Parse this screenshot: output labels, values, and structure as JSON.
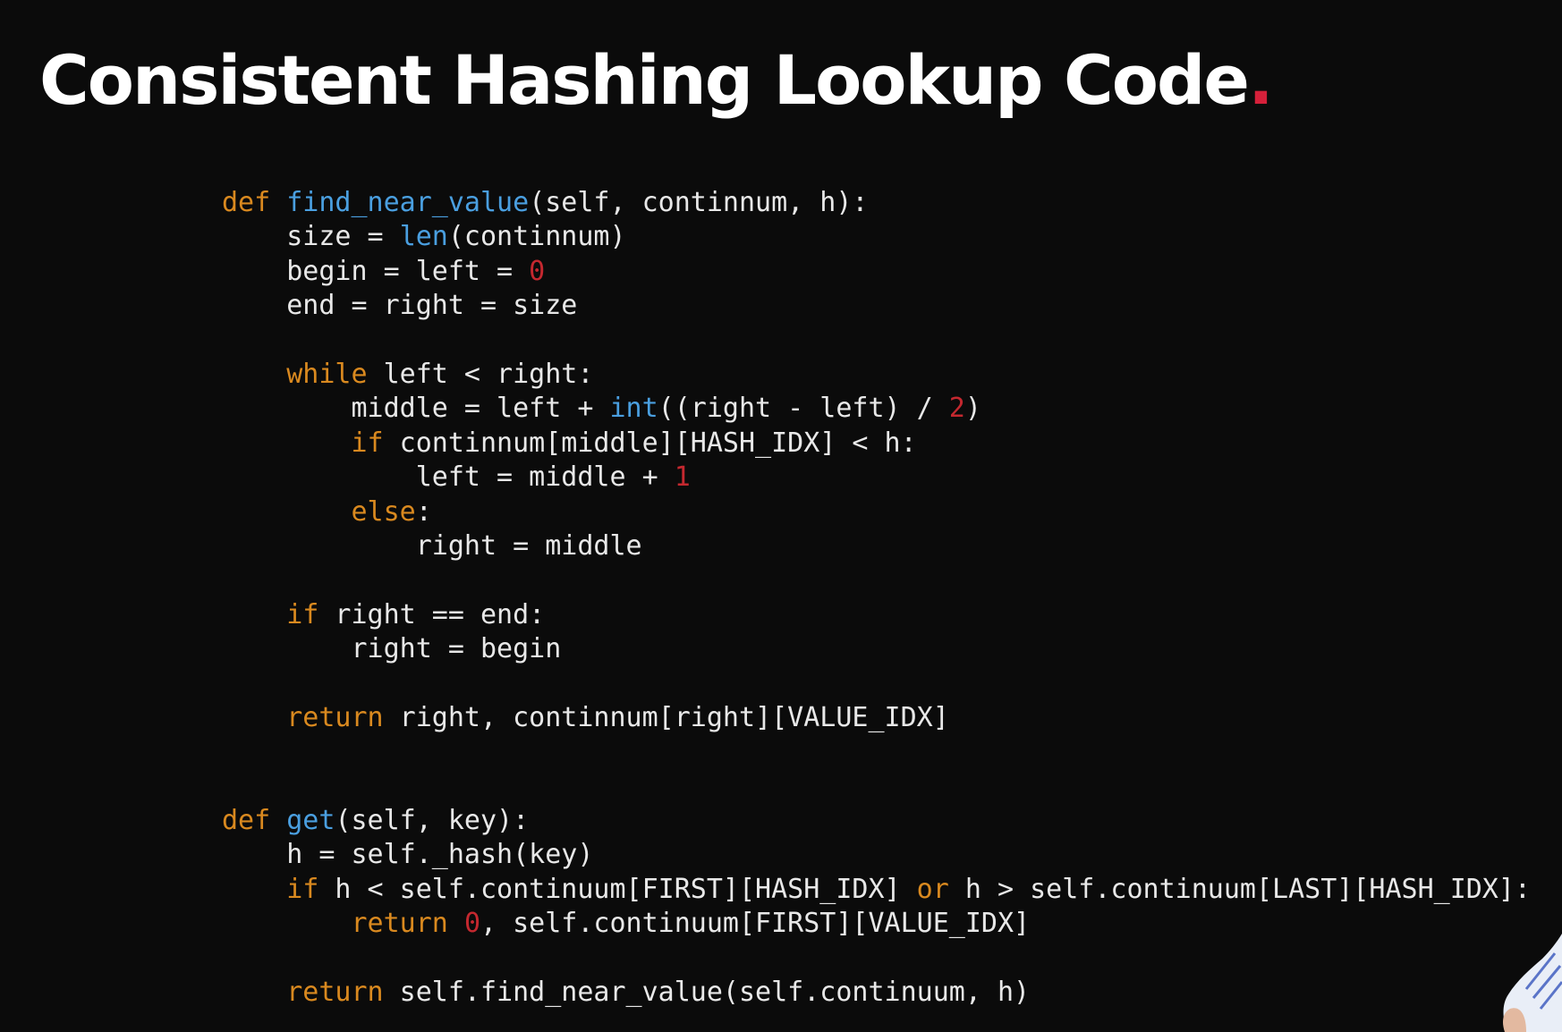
{
  "slide": {
    "title": "Consistent Hashing Lookup Code",
    "title_dot": ".",
    "accent_color": "#d6203a",
    "background_color": "#0b0b0b"
  },
  "syntax_colors": {
    "keyword": "#d9891f",
    "function": "#4a9fe0",
    "number": "#c4282f",
    "text": "#e8e8e8"
  },
  "code": {
    "language": "python",
    "lines": [
      [
        {
          "t": "kw",
          "s": "def "
        },
        {
          "t": "fn",
          "s": "find_near_value"
        },
        {
          "t": "txt",
          "s": "(self, continnum, h):"
        }
      ],
      [
        {
          "t": "txt",
          "s": "    size = "
        },
        {
          "t": "bi",
          "s": "len"
        },
        {
          "t": "txt",
          "s": "(continnum)"
        }
      ],
      [
        {
          "t": "txt",
          "s": "    begin = left = "
        },
        {
          "t": "num",
          "s": "0"
        }
      ],
      [
        {
          "t": "txt",
          "s": "    end = right = size"
        }
      ],
      [],
      [
        {
          "t": "txt",
          "s": "    "
        },
        {
          "t": "kw",
          "s": "while"
        },
        {
          "t": "txt",
          "s": " left < right:"
        }
      ],
      [
        {
          "t": "txt",
          "s": "        middle = left + "
        },
        {
          "t": "bi",
          "s": "int"
        },
        {
          "t": "txt",
          "s": "((right - left) / "
        },
        {
          "t": "num",
          "s": "2"
        },
        {
          "t": "txt",
          "s": ")"
        }
      ],
      [
        {
          "t": "txt",
          "s": "        "
        },
        {
          "t": "kw",
          "s": "if"
        },
        {
          "t": "txt",
          "s": " continnum[middle][HASH_IDX] < h:"
        }
      ],
      [
        {
          "t": "txt",
          "s": "            left = middle + "
        },
        {
          "t": "num",
          "s": "1"
        }
      ],
      [
        {
          "t": "txt",
          "s": "        "
        },
        {
          "t": "kw",
          "s": "else"
        },
        {
          "t": "txt",
          "s": ":"
        }
      ],
      [
        {
          "t": "txt",
          "s": "            right = middle"
        }
      ],
      [],
      [
        {
          "t": "txt",
          "s": "    "
        },
        {
          "t": "kw",
          "s": "if"
        },
        {
          "t": "txt",
          "s": " right == end:"
        }
      ],
      [
        {
          "t": "txt",
          "s": "        right = begin"
        }
      ],
      [],
      [
        {
          "t": "txt",
          "s": "    "
        },
        {
          "t": "kw",
          "s": "return"
        },
        {
          "t": "txt",
          "s": " right, continnum[right][VALUE_IDX]"
        }
      ],
      [],
      [],
      [
        {
          "t": "kw",
          "s": "def "
        },
        {
          "t": "fn",
          "s": "get"
        },
        {
          "t": "txt",
          "s": "(self, key):"
        }
      ],
      [
        {
          "t": "txt",
          "s": "    h = self._hash(key)"
        }
      ],
      [
        {
          "t": "txt",
          "s": "    "
        },
        {
          "t": "kw",
          "s": "if"
        },
        {
          "t": "txt",
          "s": " h < self.continuum[FIRST][HASH_IDX] "
        },
        {
          "t": "kw",
          "s": "or"
        },
        {
          "t": "txt",
          "s": " h > self.continuum[LAST][HASH_IDX]:"
        }
      ],
      [
        {
          "t": "txt",
          "s": "        "
        },
        {
          "t": "kw",
          "s": "return"
        },
        {
          "t": "txt",
          "s": " "
        },
        {
          "t": "num",
          "s": "0"
        },
        {
          "t": "txt",
          "s": ", self.continuum[FIRST][VALUE_IDX]"
        }
      ],
      [],
      [
        {
          "t": "txt",
          "s": "    "
        },
        {
          "t": "kw",
          "s": "return"
        },
        {
          "t": "txt",
          "s": " self.find_near_value(self.continuum, h)"
        }
      ]
    ]
  }
}
